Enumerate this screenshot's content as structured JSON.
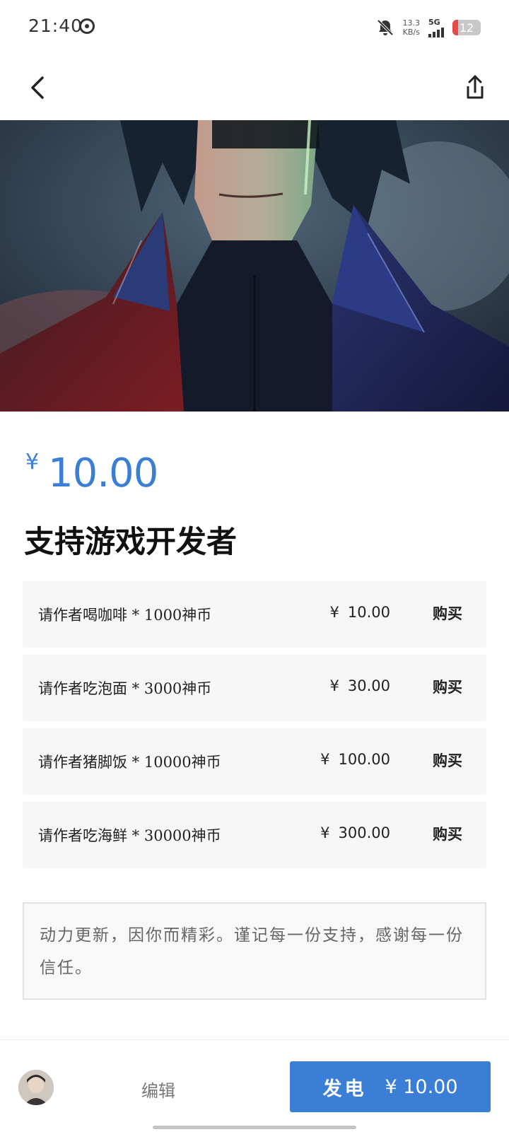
{
  "status_bar": {
    "time": "21:40",
    "speed_value": "13.3",
    "speed_unit": "KB/s",
    "network": "5G",
    "battery": "12",
    "battery_fraction": 0.12,
    "icons": [
      "sync-icon",
      "mute-bell-icon",
      "signal-icon",
      "battery-icon"
    ]
  },
  "nav": {
    "icons": [
      "chevron-left-icon",
      "share-icon"
    ]
  },
  "product": {
    "currency_symbol": "¥",
    "price": "10.00",
    "title": "支持游戏开发者"
  },
  "tiers": [
    {
      "name": "请作者喝咖啡 * 1000神币",
      "price": "10.00",
      "buy_label": "购买"
    },
    {
      "name": "请作者吃泡面 * 3000神币",
      "price": "30.00",
      "buy_label": "购买"
    },
    {
      "name": "请作者猪脚饭 * 10000神币",
      "price": "100.00",
      "buy_label": "购买"
    },
    {
      "name": "请作者吃海鲜 * 30000神币",
      "price": "300.00",
      "buy_label": "购买"
    }
  ],
  "tier_currency": "¥",
  "message": "动力更新，因你而精彩。谨记每一份支持，感谢每一份信任。",
  "bottom_bar": {
    "edit_label": "编辑",
    "donate_label": "发电",
    "donate_amount": "¥ 10.00"
  },
  "colors": {
    "accent": "#3a7fd5"
  }
}
